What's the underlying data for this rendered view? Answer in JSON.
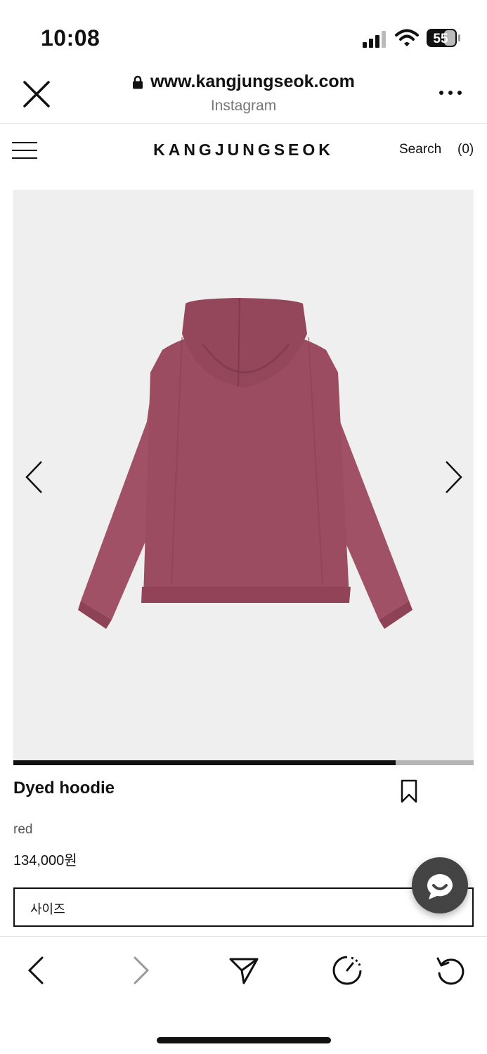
{
  "status": {
    "time": "10:08",
    "battery": "55"
  },
  "browser": {
    "url": "www.kangjungseok.com",
    "source": "Instagram"
  },
  "site": {
    "brand": "KANGJUNGSEOK",
    "search_label": "Search",
    "cart_label": "(0)"
  },
  "gallery": {
    "image_icon": "hoodie-image",
    "garment_color": "#9c4c60",
    "progress": 0.83
  },
  "product": {
    "name": "Dyed hoodie",
    "color": "red",
    "price": "134,000원",
    "size_label": "사이즈"
  },
  "toolbar": {
    "icons": [
      "back-icon",
      "forward-icon",
      "share-icon",
      "timer-icon",
      "reload-icon"
    ]
  }
}
